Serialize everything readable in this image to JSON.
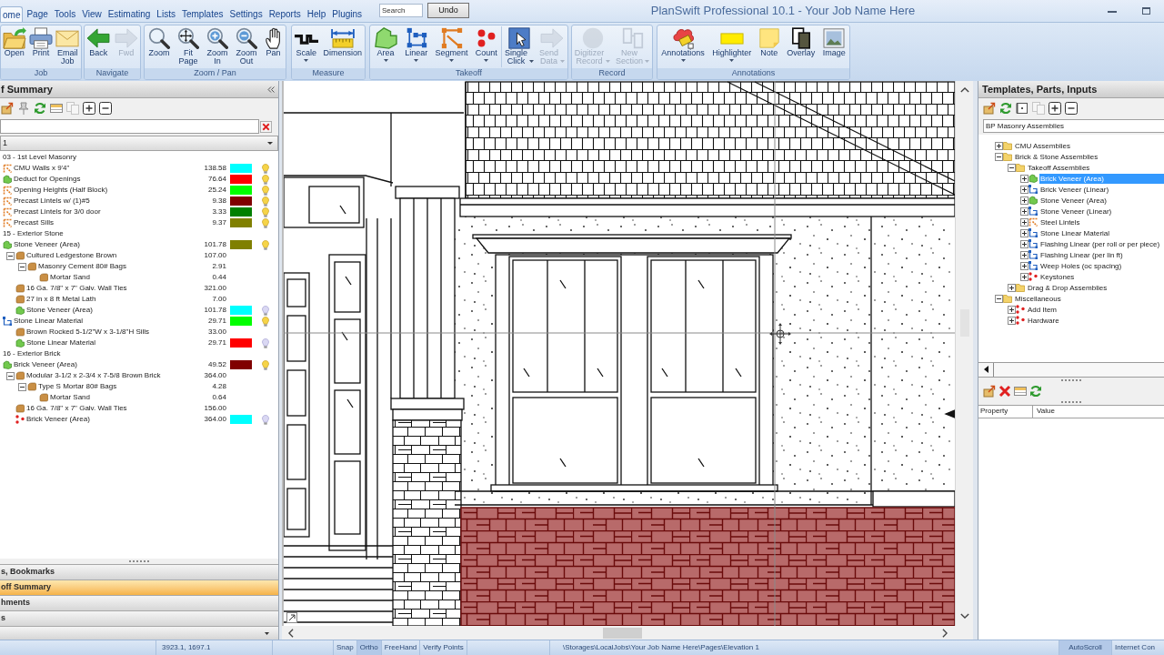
{
  "window": {
    "title": "PlanSwift Professional 10.1 - Your Job Name Here"
  },
  "menu_tabs": [
    {
      "label": "ome",
      "selected": true
    },
    {
      "label": "Page",
      "selected": false
    },
    {
      "label": "Tools",
      "selected": false
    },
    {
      "label": "View",
      "selected": false
    },
    {
      "label": "Estimating",
      "selected": false
    },
    {
      "label": "Lists",
      "selected": false
    },
    {
      "label": "Templates",
      "selected": false
    },
    {
      "label": "Settings",
      "selected": false
    },
    {
      "label": "Reports",
      "selected": false
    },
    {
      "label": "Help",
      "selected": false
    },
    {
      "label": "Plugins",
      "selected": false
    }
  ],
  "quick_search": {
    "placeholder": "Search"
  },
  "undo_button": {
    "label": "Undo"
  },
  "ribbon": {
    "groups": [
      {
        "label": "Job",
        "sections": [
          {
            "buttons": [
              {
                "label": "Open",
                "disabled": false,
                "menu": false
              },
              {
                "label": "Print",
                "disabled": false,
                "menu": false
              },
              {
                "label": "Email Job",
                "disabled": false,
                "menu": false
              }
            ]
          }
        ]
      },
      {
        "label": "Navigate",
        "sections": [
          {
            "buttons": [
              {
                "label": "Back",
                "disabled": false,
                "menu": false
              },
              {
                "label": "Fwd",
                "disabled": true,
                "menu": false
              }
            ]
          }
        ]
      },
      {
        "label": "Zoom / Pan",
        "sections": [
          {
            "buttons": [
              {
                "label": "Zoom",
                "disabled": false,
                "menu": false
              },
              {
                "label": "Fit Page",
                "disabled": false,
                "menu": false
              },
              {
                "label": "Zoom In",
                "disabled": false,
                "menu": false
              },
              {
                "label": "Zoom Out",
                "disabled": false,
                "menu": false
              },
              {
                "label": "Pan",
                "disabled": false,
                "menu": false
              }
            ]
          }
        ]
      },
      {
        "label": "Measure",
        "sections": [
          {
            "buttons": [
              {
                "label": "Scale",
                "disabled": false,
                "menu": true
              },
              {
                "label": "Dimension",
                "disabled": false,
                "menu": false
              }
            ]
          }
        ]
      },
      {
        "label": "Takeoff",
        "sections": [
          {
            "buttons": [
              {
                "label": "Area",
                "disabled": false,
                "menu": true
              },
              {
                "label": "Linear",
                "disabled": false,
                "menu": true
              },
              {
                "label": "Segment",
                "disabled": false,
                "menu": true
              },
              {
                "label": "Count",
                "disabled": false,
                "menu": true
              }
            ]
          },
          {
            "buttons": [
              {
                "label": "Single Click",
                "disabled": false,
                "menu": true
              },
              {
                "label": "Send Data",
                "disabled": true,
                "menu": true
              }
            ]
          }
        ]
      },
      {
        "label": "Record",
        "sections": [
          {
            "buttons": [
              {
                "label": "Digitizer Record",
                "disabled": true,
                "menu": true
              },
              {
                "label": "New Section",
                "disabled": true,
                "menu": true
              }
            ]
          }
        ]
      },
      {
        "label": "Annotations",
        "sections": [
          {
            "buttons": [
              {
                "label": "Annotations",
                "disabled": false,
                "menu": true
              },
              {
                "label": "Highlighter",
                "disabled": false,
                "menu": true
              },
              {
                "label": "Note",
                "disabled": false,
                "menu": false
              },
              {
                "label": "Overlay",
                "disabled": false,
                "menu": false
              },
              {
                "label": "Image",
                "disabled": false,
                "menu": false
              }
            ]
          }
        ]
      }
    ]
  },
  "takeoff_summary": {
    "title": "f Summary",
    "toolbar": [
      {
        "disabled": false
      },
      {
        "disabled": false
      },
      {
        "disabled": false
      },
      {
        "disabled": false
      },
      {
        "disabled": true
      },
      {
        "disabled": false
      },
      {
        "disabled": false
      }
    ],
    "filter": {
      "value": "1"
    },
    "items": [
      {
        "kind": "heading",
        "label": "03 - 1st Level Masonry"
      },
      {
        "kind": "segment",
        "label": "CMU Walls x 9'4\"",
        "value": "138.58",
        "color": "#00ffff",
        "visible": true
      },
      {
        "kind": "area",
        "label": "Deduct for Openings",
        "value": "76.64",
        "color": "#ff0000",
        "visible": true
      },
      {
        "kind": "segment",
        "label": "Opening Heights (Half Block)",
        "value": "25.24",
        "color": "#00ff00",
        "visible": true
      },
      {
        "kind": "segment",
        "label": "Precast Lintels w/ (1)#5",
        "value": "9.38",
        "color": "#800000",
        "visible": true
      },
      {
        "kind": "segment",
        "label": "Precast Lintels for 3/0 door",
        "value": "3.33",
        "color": "#008000",
        "visible": true
      },
      {
        "kind": "segment",
        "label": "Precast Sills",
        "value": "9.37",
        "color": "#808000",
        "visible": true
      },
      {
        "kind": "heading",
        "label": "15 - Exterior Stone"
      },
      {
        "kind": "area",
        "label": "Stone Veneer (Area)",
        "value": "101.78",
        "color": "#808000",
        "visible": true,
        "children": [
          {
            "kind": "part",
            "label": "Cultured Ledgestone Brown",
            "value": "107.00",
            "expanded": true,
            "children": [
              {
                "kind": "part",
                "label": "Masonry Cement 80# Bags",
                "value": "2.91",
                "expanded": true,
                "children": [
                  {
                    "kind": "part",
                    "label": "Mortar Sand",
                    "value": "0.44"
                  }
                ]
              }
            ]
          },
          {
            "kind": "part",
            "label": "16 Ga. 7/8\" x 7\" Galv. Wall Ties",
            "value": "321.00"
          },
          {
            "kind": "part",
            "label": "27 in x 8 ft Metal Lath",
            "value": "7.00"
          },
          {
            "kind": "area",
            "label": "Stone Veneer (Area)",
            "value": "101.78",
            "color": "#00ffff",
            "visible": false
          }
        ]
      },
      {
        "kind": "linear",
        "label": "Stone Linear Material",
        "value": "29.71",
        "color": "#00ff00",
        "visible": true,
        "children": [
          {
            "kind": "part",
            "label": "Brown Rocked 5-1/2\"W x 3-1/8\"H Sills",
            "value": "33.00"
          },
          {
            "kind": "area",
            "label": "Stone Linear Material",
            "value": "29.71",
            "color": "#ff0000",
            "visible": false
          }
        ]
      },
      {
        "kind": "heading",
        "label": "16 - Exterior Brick"
      },
      {
        "kind": "area",
        "label": "Brick Veneer (Area)",
        "value": "49.52",
        "color": "#800000",
        "visible": true,
        "children": [
          {
            "kind": "part",
            "label": "Modular 3-1/2 x 2-3/4 x 7-5/8 Brown Brick",
            "value": "364.00",
            "expanded": true,
            "children": [
              {
                "kind": "part",
                "label": "Type S Mortar 80# Bags",
                "value": "4.28",
                "expanded": true,
                "children": [
                  {
                    "kind": "part",
                    "label": "Mortar Sand",
                    "value": "0.64"
                  }
                ]
              }
            ]
          },
          {
            "kind": "part",
            "label": "16 Ga. 7/8\" x 7\" Galv. Wall Ties",
            "value": "156.00"
          },
          {
            "kind": "count",
            "label": "Brick Veneer (Area)",
            "value": "364.00",
            "color": "#00ffff",
            "visible": false
          }
        ]
      }
    ]
  },
  "navigation_pane": {
    "bars": [
      {
        "label": "s, Bookmarks",
        "selected": false
      },
      {
        "label": "off Summary",
        "selected": true
      },
      {
        "label": "hments",
        "selected": false
      },
      {
        "label": "s",
        "selected": false
      }
    ]
  },
  "templates_panel": {
    "title": "Templates, Parts, Inputs",
    "toolbar": [
      {
        "disabled": false
      },
      {
        "disabled": false
      },
      {
        "disabled": false
      },
      {
        "disabled": true
      },
      {
        "disabled": false
      },
      {
        "disabled": false
      }
    ],
    "library": {
      "value": "BP Masonry Assemblies"
    },
    "tree": [
      {
        "kind": "folder",
        "label": "CMU Assemblies",
        "expanded": false,
        "selected": false
      },
      {
        "kind": "folder",
        "label": "Brick & Stone Assemblies",
        "expanded": true,
        "selected": false,
        "children": [
          {
            "kind": "folder",
            "label": "Takeoff Assemblies",
            "expanded": true,
            "selected": false,
            "children": [
              {
                "kind": "area",
                "label": "Brick Veneer (Area)",
                "expanded": false,
                "selected": true
              },
              {
                "kind": "linear",
                "label": "Brick Veneer (Linear)",
                "expanded": false,
                "selected": false
              },
              {
                "kind": "area",
                "label": "Stone Veneer (Area)",
                "expanded": false,
                "selected": false
              },
              {
                "kind": "linear",
                "label": "Stone Veneer (Linear)",
                "expanded": false,
                "selected": false
              },
              {
                "kind": "segment",
                "label": "Steel Lintels",
                "expanded": false,
                "selected": false
              },
              {
                "kind": "linear",
                "label": "Stone Linear Material",
                "expanded": false,
                "selected": false
              },
              {
                "kind": "linear",
                "label": "Flashing Linear (per roll or per piece)",
                "expanded": false,
                "selected": false
              },
              {
                "kind": "linear",
                "label": "Flashing Linear (per lin ft)",
                "expanded": false,
                "selected": false
              },
              {
                "kind": "linear",
                "label": "Weep Holes (oc spacing)",
                "expanded": false,
                "selected": false
              },
              {
                "kind": "count",
                "label": "Keystones",
                "expanded": false,
                "selected": false
              }
            ]
          },
          {
            "kind": "folder",
            "label": "Drag & Drop Assemblies",
            "expanded": false,
            "selected": false
          }
        ]
      },
      {
        "kind": "folder",
        "label": "Miscellaneous",
        "expanded": true,
        "selected": false,
        "children": [
          {
            "kind": "count",
            "label": "Add Item",
            "expanded": false,
            "selected": false
          },
          {
            "kind": "count",
            "label": "Hardware",
            "expanded": false,
            "selected": false
          }
        ]
      }
    ]
  },
  "properties_panel": {
    "toolbar": [
      {
        "disabled": false
      },
      {
        "disabled": false
      },
      {
        "disabled": false
      },
      {
        "disabled": false
      }
    ],
    "columns": [
      "Property",
      "Value"
    ]
  },
  "status_bar": {
    "coordinates": "3923.1, 1697.1",
    "toggles": [
      {
        "label": "Snap",
        "on": false
      },
      {
        "label": "Ortho",
        "on": true
      },
      {
        "label": "FreeHand",
        "on": false
      },
      {
        "label": "Verify Points",
        "on": false
      }
    ],
    "path": "\\Storages\\LocalJobs\\Your Job Name Here\\Pages\\Elevation 1",
    "autoscroll": {
      "label": "AutoScroll",
      "on": true
    },
    "connection": "Internet Con"
  }
}
